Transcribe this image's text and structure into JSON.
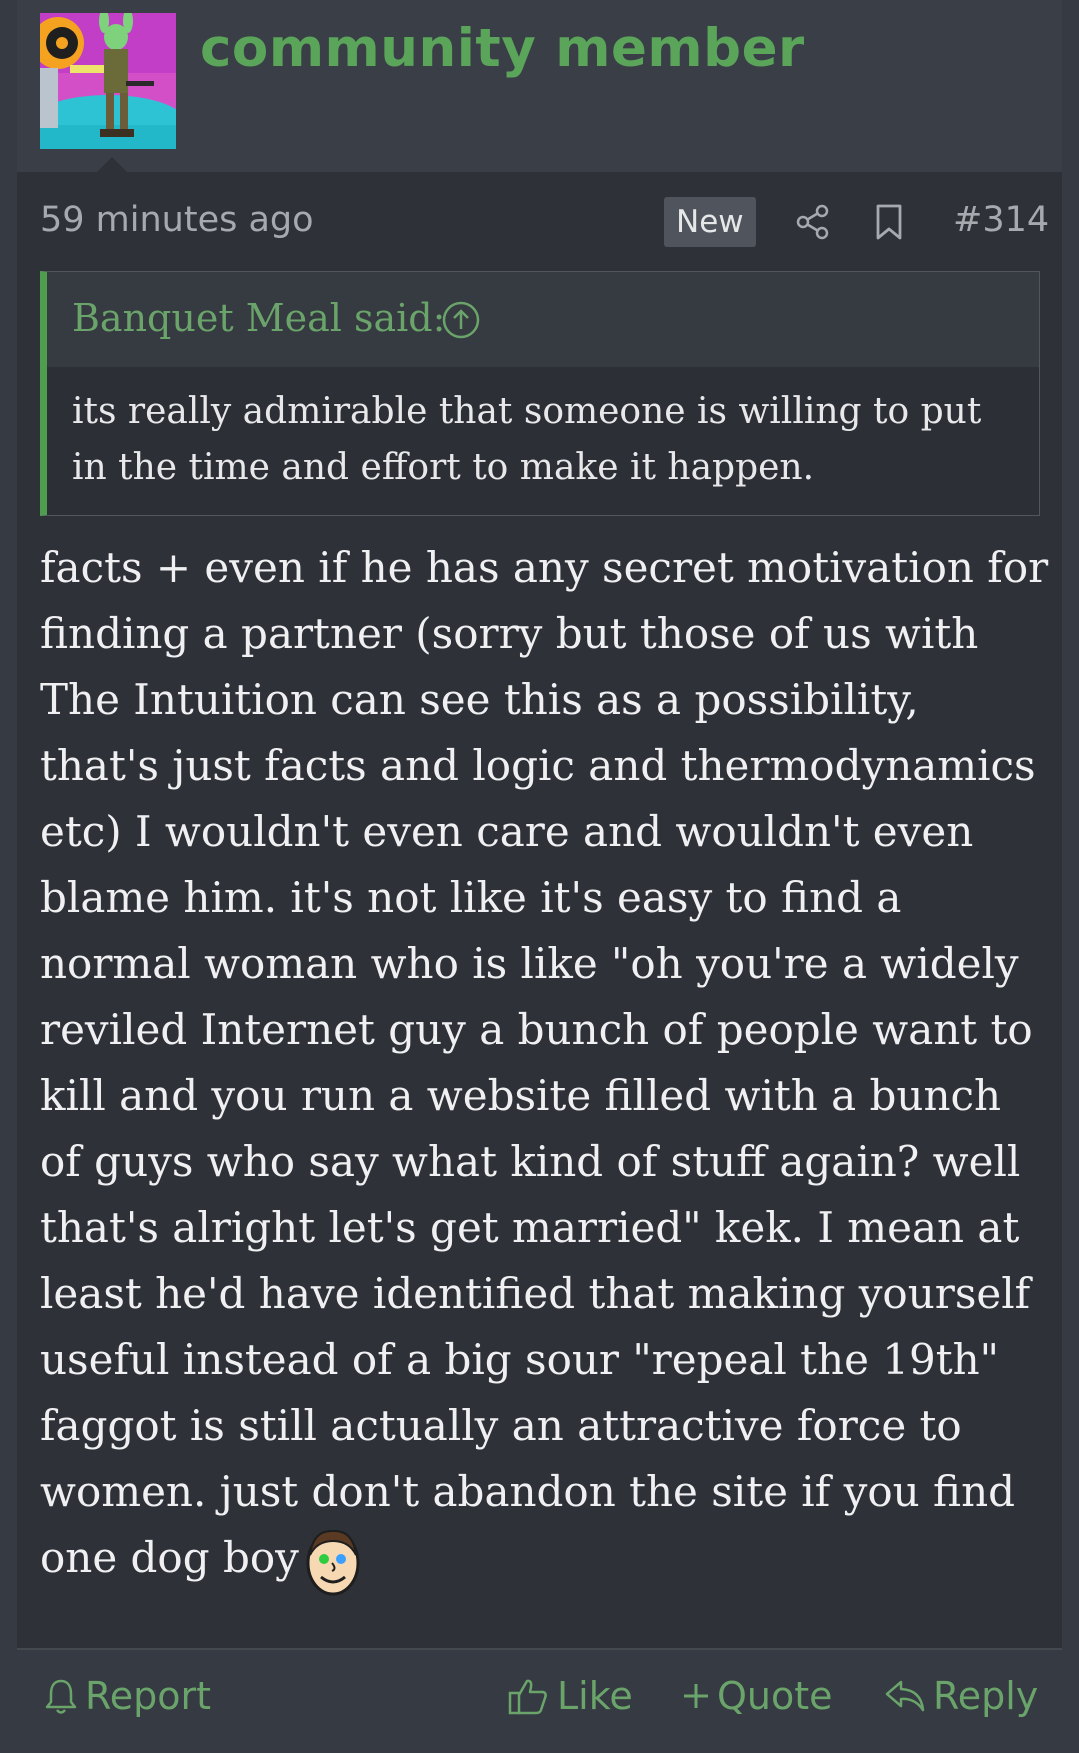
{
  "author": {
    "username": "community member"
  },
  "meta": {
    "timestamp": "59 minutes ago",
    "badge": "New",
    "post_number": "#314"
  },
  "quote": {
    "author_line": "Banquet Meal said:",
    "body": "its really admirable that someone is willing to put in the time and effort to make it happen."
  },
  "message": {
    "body": "facts + even if he has any secret motivation for finding a partner (sorry but those of us with The Intuition can see this as a possibility, that's just facts and logic and thermodynamics etc) I wouldn't even care and wouldn't even blame him. it's not like it's easy to find a normal woman who is like \"oh you're a widely reviled Internet guy a bunch of people want to kill and you run a website filled with a bunch of guys who say what kind of stuff again? well that's alright let's get married\" kek. I mean at least he'd have identified that making yourself useful instead of a big sour \"repeal the 19th\" faggot is still actually an attractive force to women. just don't abandon the site if you find one dog boy"
  },
  "actions": {
    "report": "Report",
    "like": "Like",
    "quote": "Quote",
    "reply": "Reply"
  },
  "colors": {
    "accent_green": "#5aa55a",
    "background": "#2e3138",
    "header": "#3a3e46"
  },
  "icons": {
    "share": "share-icon",
    "bookmark": "bookmark-icon",
    "jump": "arrow-up-circle-icon",
    "report": "bell-icon",
    "like": "thumbs-up-icon",
    "quote": "plus-icon",
    "reply": "reply-arrow-icon",
    "emoji": "smiley-face-emoji"
  }
}
